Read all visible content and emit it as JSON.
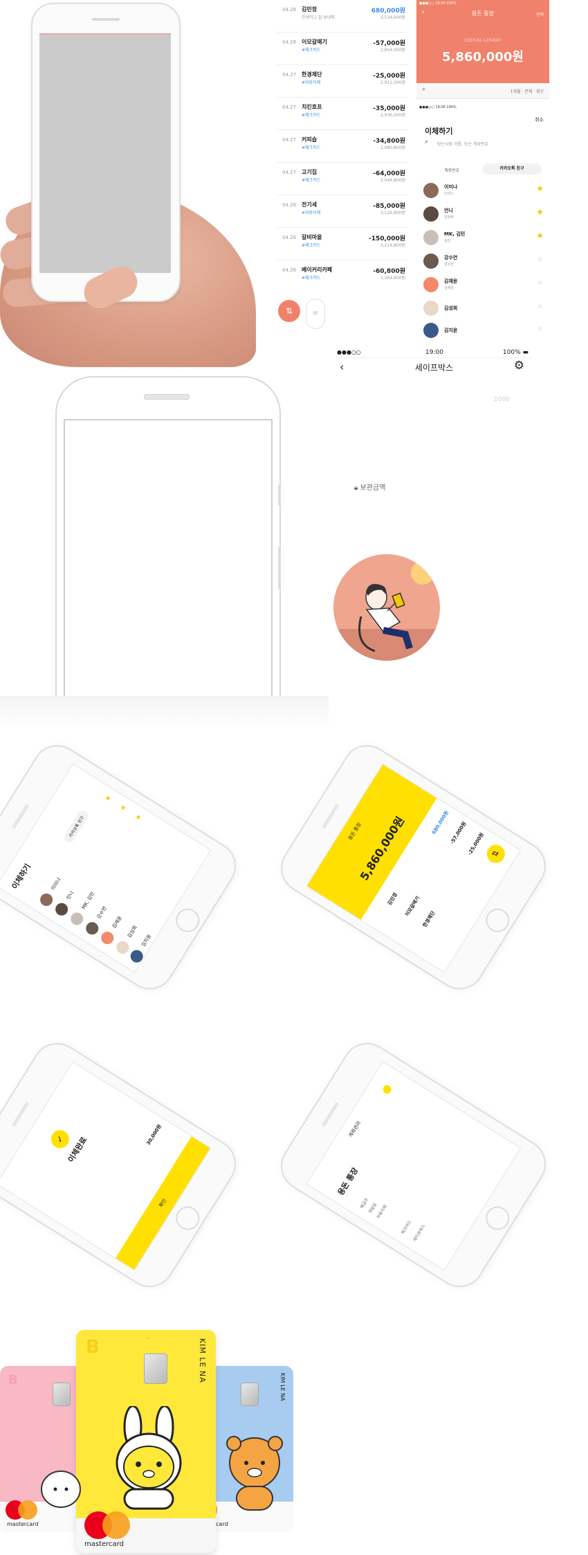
{
  "transactions": [
    {
      "date": "04.28",
      "name": "김민정",
      "tag": "인생이고 잘 보내줘",
      "amount": "680,000원",
      "balance": "3,534,000원",
      "positive": true
    },
    {
      "date": "04.28",
      "name": "이모갈매기",
      "tag": "#체크카드",
      "amount": "-57,000원",
      "balance": "2,854,000원",
      "positive": false
    },
    {
      "date": "04.27",
      "name": "한경제단",
      "tag": "#자동이체",
      "amount": "-25,000원",
      "balance": "2,911,000원",
      "positive": false
    },
    {
      "date": "04.27",
      "name": "치킨호프",
      "tag": "#체크카드",
      "amount": "-35,000원",
      "balance": "2,936,000원",
      "positive": false
    },
    {
      "date": "04.27",
      "name": "커피숍",
      "tag": "#체크카드",
      "amount": "-34,800원",
      "balance": "2,980,800원",
      "positive": false
    },
    {
      "date": "04.27",
      "name": "고기집",
      "tag": "#체크카드",
      "amount": "-64,000원",
      "balance": "3,044,800원",
      "positive": false
    },
    {
      "date": "04.26",
      "name": "전기세",
      "tag": "#자동이체",
      "amount": "-85,000원",
      "balance": "3,129,800원",
      "positive": false
    },
    {
      "date": "04.26",
      "name": "갈비마을",
      "tag": "#체크카드",
      "amount": "-150,000원",
      "balance": "3,214,800원",
      "positive": false
    },
    {
      "date": "04.26",
      "name": "베이커리카페",
      "tag": "#체크카드",
      "amount": "-60,800원",
      "balance": "3,364,800원",
      "positive": false
    }
  ],
  "account": {
    "status_time": "19:00",
    "status_battery": "100%",
    "title": "용돈 통장",
    "manage": "관리",
    "account_number": "3333-02-1234567",
    "balance": "5,860,000원",
    "filter": "1개월 · 전체 · 최신"
  },
  "transfer": {
    "status_time": "19:00",
    "status_battery": "100%",
    "cancel": "취소",
    "title": "이체하기",
    "search_placeholder": "받는사람 이름, 또는 계좌번호",
    "tab_account": "계좌번호",
    "tab_friends": "카카오톡 친구",
    "contacts": [
      {
        "name": "이미나",
        "sub": "이미나",
        "starred": true,
        "color": "#8a6a58"
      },
      {
        "name": "언니",
        "sub": "친화주",
        "starred": true,
        "color": "#5b4a40"
      },
      {
        "name": "MK, 김민",
        "sub": "김민",
        "starred": true,
        "color": "#c8c0b8"
      },
      {
        "name": "강수연",
        "sub": "강수연",
        "starred": false,
        "color": "#6a5a50"
      },
      {
        "name": "김재윤",
        "sub": "김재윤",
        "starred": false,
        "color": "#f08a6a"
      },
      {
        "name": "김성희",
        "sub": "",
        "starred": false,
        "color": "#e8d8c8"
      },
      {
        "name": "김지윤",
        "sub": "",
        "starred": false,
        "color": "#3a5a8a"
      }
    ]
  },
  "safebox": {
    "status_time": "19:00",
    "status_battery": "100%",
    "title": "세이프박스",
    "amount_hint": "1000",
    "label": "보관금액"
  },
  "mockups": {
    "m1_title": "이체하기",
    "m1_contacts": [
      "이미나",
      "언니",
      "MK, 김민",
      "강수연",
      "김재윤",
      "김성희",
      "김지윤"
    ],
    "m1_tab": "카카오톡 친구",
    "m2_title": "용돈 통장",
    "m2_balance": "5,860,000원",
    "m2_rows": [
      "김민정",
      "이모갈매기",
      "한경제단"
    ],
    "m2_amounts": [
      "680,000원",
      "-57,000원",
      "-25,000원"
    ],
    "m3_title": "이체완료",
    "m3_amount": "30,000원",
    "m3_button": "확인",
    "m4_title": "용돈 통장",
    "m4_header": "계좌관리",
    "m4_rows": [
      "예금주",
      "개설일",
      "자동이체",
      "체크카드",
      "세이프박스"
    ]
  },
  "cards": [
    {
      "name": "KIM LE NA",
      "color": "#f8b9c4",
      "brand": "mastercard"
    },
    {
      "name": "KIM LE NA",
      "color": "#ffe83a",
      "brand": "mastercard"
    },
    {
      "name": "KIM LE NA",
      "color": "#a8ccf0",
      "brand": "mastercard"
    }
  ],
  "colors": {
    "accent": "#f0816a",
    "yellow": "#ffe000",
    "blue": "#3a8ee6",
    "star": "#f5c800"
  },
  "icons": {
    "fab": "transfer-icon",
    "menu": "menu-icon",
    "gear": "gear-icon",
    "lock": "lock-icon",
    "back": "back-icon",
    "search": "search-icon"
  }
}
